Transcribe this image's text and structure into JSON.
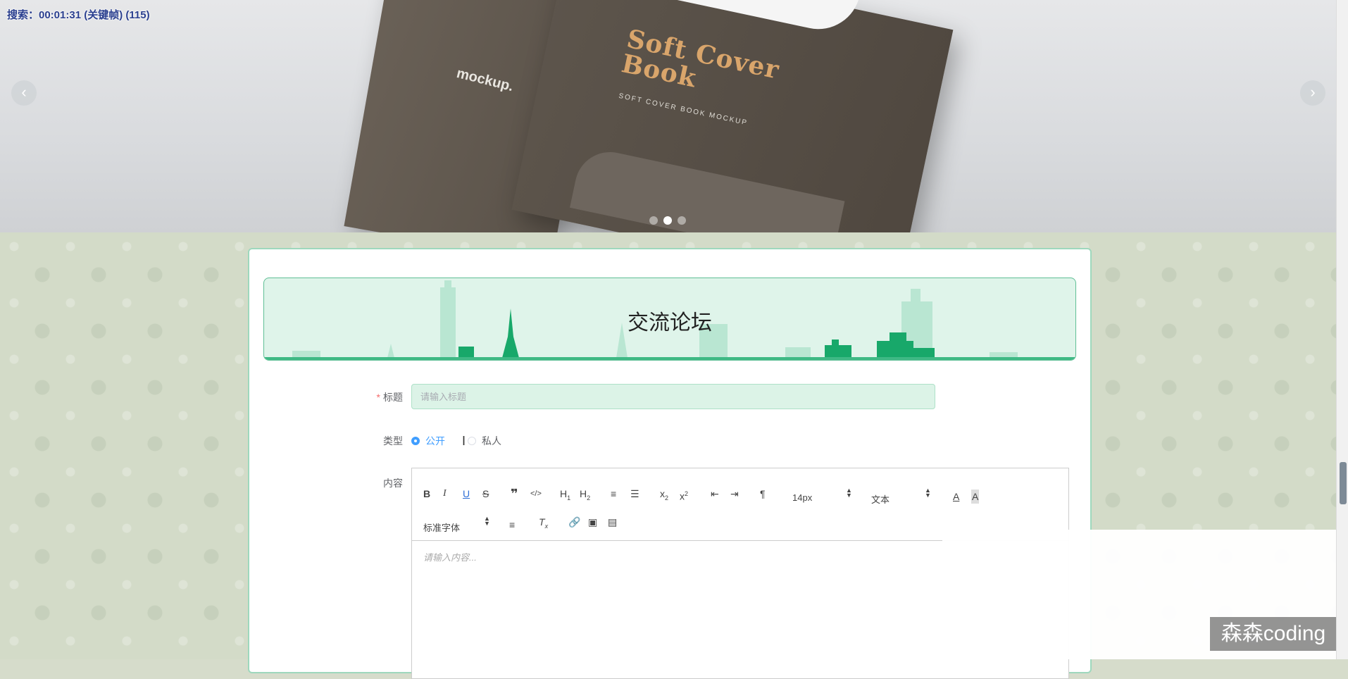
{
  "overlay": {
    "timer": "搜索：00:01:31 (关键帧) (115)"
  },
  "banner": {
    "book_back_title": "mockup.",
    "book_front_title": "Soft Cover Book",
    "book_front_sub": "SOFT COVER BOOK MOCKUP",
    "prev_label": "‹",
    "next_label": "›",
    "slides": 3,
    "active_slide": 2
  },
  "forum": {
    "header_title": "交流论坛",
    "title_label": "标题",
    "title_placeholder": "请输入标题",
    "type_label": "类型",
    "type_options": [
      "公开",
      "私人"
    ],
    "type_selected": "公开",
    "content_label": "内容",
    "content_placeholder": "请输入内容...",
    "toolbar": {
      "font_size": "14px",
      "header_select": "文本",
      "font_family": "标准字体"
    }
  },
  "watermark": "森森coding",
  "colors": {
    "accent": "#409eff",
    "header_bg": "#dff4ea",
    "header_border": "#5fbf95",
    "city_green": "#18a86a"
  }
}
